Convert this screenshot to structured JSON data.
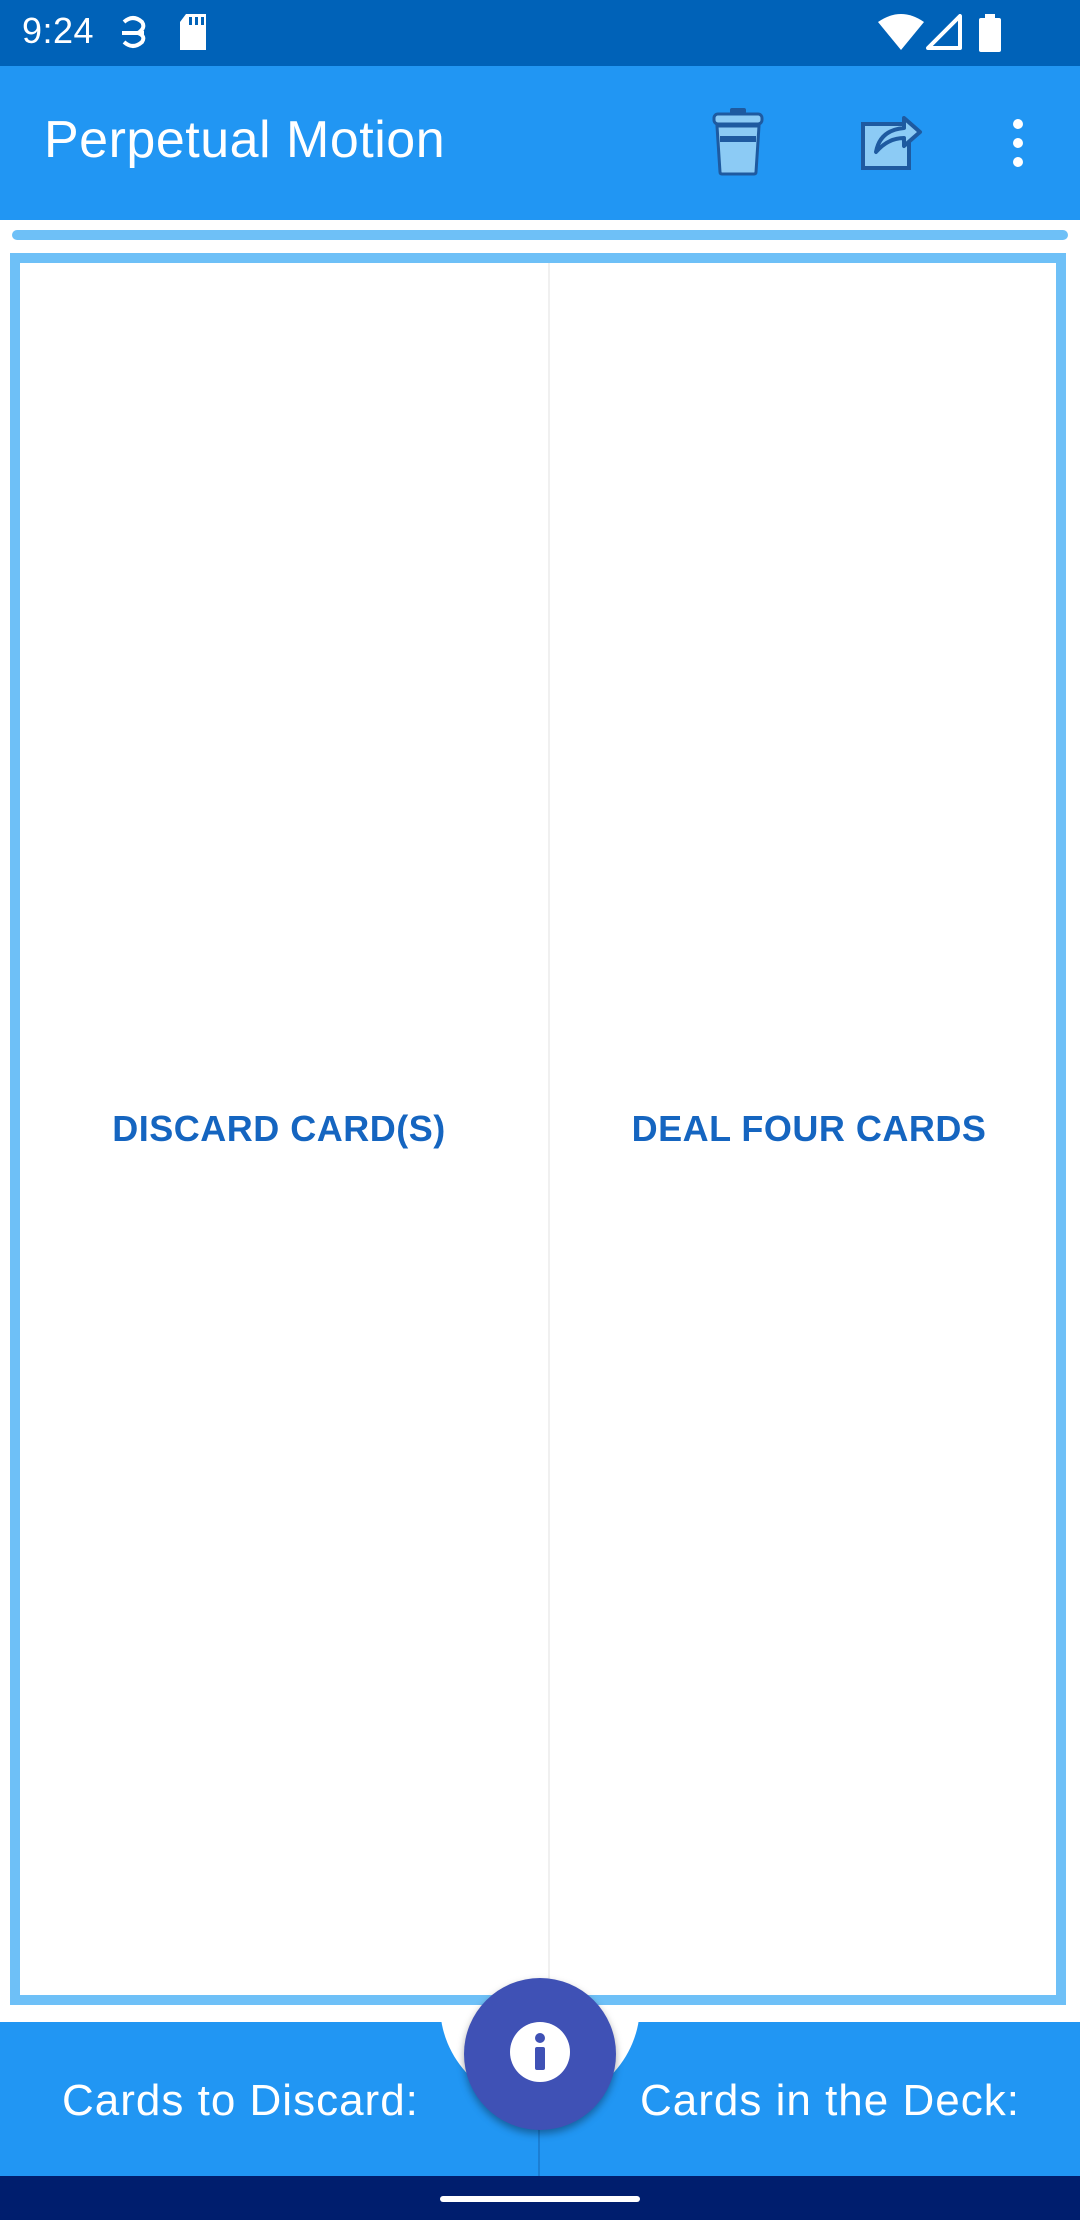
{
  "status_bar": {
    "time": "9:24",
    "left_icons": [
      "data-saver-icon",
      "sd-card-icon"
    ],
    "right_icons": [
      "wifi-icon",
      "cellular-signal-icon",
      "battery-icon"
    ],
    "background_color": "#0062b8"
  },
  "app_bar": {
    "title": "Perpetual Motion",
    "actions": [
      "trash-icon",
      "share-icon",
      "more-vert-icon"
    ],
    "background_color": "#2196f3"
  },
  "play_area": {
    "border_color": "#6ec0f7",
    "left_zone_label": "DISCARD CARD(S)",
    "right_zone_label": "DEAL FOUR CARDS",
    "label_color": "#1565c0"
  },
  "bottom_bar": {
    "left_label": "Cards to Discard:",
    "right_label": "Cards in the Deck:",
    "background_color": "#2196f3"
  },
  "fab": {
    "icon": "info-icon",
    "color": "#3f51b5"
  },
  "nav_bar": {
    "background_color": "#001e6e"
  }
}
